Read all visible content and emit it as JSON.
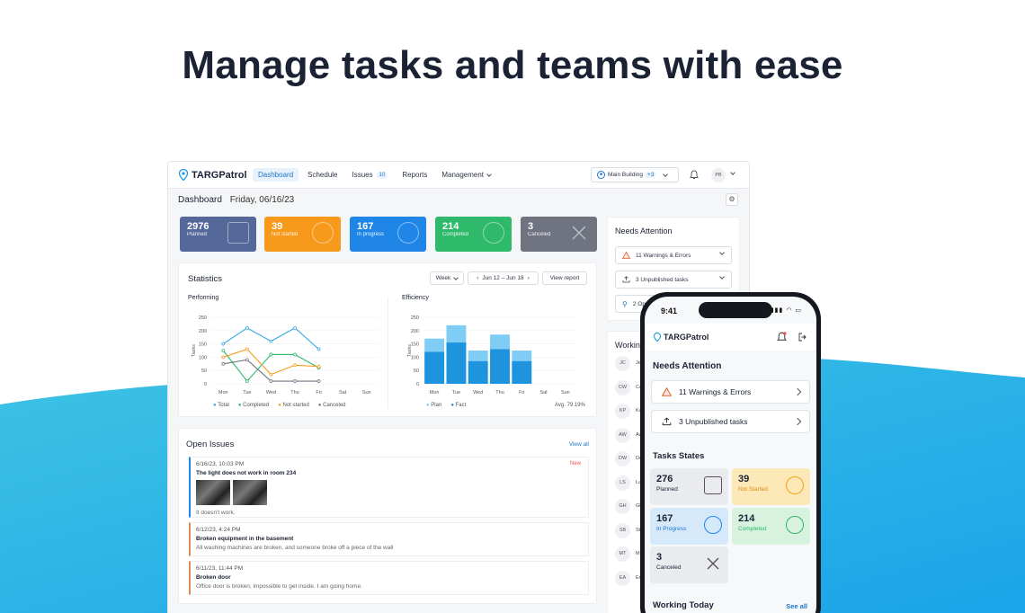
{
  "hero": {
    "title": "Manage tasks and teams with ease"
  },
  "app": {
    "brand": "TARGPatrol",
    "nav": [
      {
        "label": "Dashboard",
        "active": true
      },
      {
        "label": "Schedule"
      },
      {
        "label": "Issues",
        "badge": "10"
      },
      {
        "label": "Reports"
      },
      {
        "label": "Management"
      }
    ],
    "building": {
      "label": "Main Building",
      "extra": "+3"
    },
    "user_initials": "PB",
    "dashboard_title": "Dashboard",
    "dashboard_date": "Friday, 06/16/23"
  },
  "stats": [
    {
      "value": "2976",
      "label": "Planned",
      "color": "#4e5f8c"
    },
    {
      "value": "39",
      "label": "Not started",
      "color": "#f79a1c"
    },
    {
      "value": "167",
      "label": "In progress",
      "color": "#1f86e8"
    },
    {
      "value": "214",
      "label": "Completed",
      "color": "#2fb96a"
    },
    {
      "value": "3",
      "label": "Canceled",
      "color": "#6f7480"
    }
  ],
  "statistics": {
    "title": "Statistics",
    "period": "Week",
    "range": "Jun 12 – Jun 18",
    "view_report": "View report",
    "avg": "Avg. 79.19%"
  },
  "chart_data": [
    {
      "type": "line",
      "title": "Performing",
      "ylabel": "Tasks",
      "categories": [
        "Mon",
        "Tue",
        "Wed",
        "Thu",
        "Fri",
        "Sat",
        "Sun"
      ],
      "yticks": [
        0,
        50,
        100,
        150,
        200,
        250
      ],
      "ylim": [
        0,
        250
      ],
      "series": [
        {
          "name": "Total",
          "color": "#35a9e0",
          "values": [
            150,
            210,
            160,
            210,
            130
          ]
        },
        {
          "name": "Completed",
          "color": "#2fb96a",
          "values": [
            125,
            10,
            110,
            110,
            60
          ]
        },
        {
          "name": "Not started",
          "color": "#f79a1c",
          "values": [
            100,
            130,
            35,
            70,
            65
          ]
        },
        {
          "name": "Canceled",
          "color": "#6f7480",
          "values": [
            75,
            90,
            10,
            10,
            10
          ]
        }
      ]
    },
    {
      "type": "bar",
      "title": "Efficiency",
      "ylabel": "Tasks",
      "categories": [
        "Mon",
        "Tue",
        "Wed",
        "Thu",
        "Fri",
        "Sat",
        "Sun"
      ],
      "yticks": [
        0,
        50,
        100,
        150,
        200,
        250
      ],
      "ylim": [
        0,
        250
      ],
      "series": [
        {
          "name": "Plan",
          "color": "#7fcdf5",
          "values": [
            170,
            220,
            125,
            185,
            125
          ]
        },
        {
          "name": "Fact",
          "color": "#1f94de",
          "values": [
            120,
            155,
            85,
            130,
            85
          ]
        }
      ]
    }
  ],
  "needs_attention": {
    "title": "Needs Attention",
    "rows": [
      "11 Warnings & Errors",
      "3 Unpublished tasks",
      "2 Open"
    ]
  },
  "working": {
    "title": "Working",
    "people": [
      {
        "initials": "JC",
        "text": "Je"
      },
      {
        "initials": "CW",
        "text": "Ca"
      },
      {
        "initials": "KP",
        "text": "Ka"
      },
      {
        "initials": "AW",
        "text": "Aw"
      },
      {
        "initials": "DW",
        "text": "De"
      },
      {
        "initials": "LS",
        "text": "La"
      },
      {
        "initials": "GH",
        "text": "Gl"
      },
      {
        "initials": "SB",
        "text": "St"
      },
      {
        "initials": "MT",
        "text": "Mi"
      },
      {
        "initials": "EA",
        "text": "Er"
      }
    ]
  },
  "issues": {
    "title": "Open Issues",
    "view_all": "View all",
    "items": [
      {
        "time": "6/16/23, 10:03 PM",
        "title": "The light does not work in room 234",
        "desc": "It doesn't work.",
        "tag": "New",
        "color": "#1f86e8"
      },
      {
        "time": "6/12/23, 4:24 PM",
        "title": "Broken equipment in the basement",
        "desc": "All washing machines are broken, and someone broke off a piece of the wall",
        "color": "#e07a4a"
      },
      {
        "time": "6/11/23, 11:44 PM",
        "title": "Broken door",
        "desc": "Office door is broken, impossible to get inside. I am going home.",
        "color": "#e07a4a"
      }
    ]
  },
  "phone": {
    "time": "9:41",
    "brand": "TARGPatrol",
    "attention_title": "Needs Attention",
    "attention": [
      "11 Warnings & Errors",
      "3 Unpublished tasks"
    ],
    "states_title": "Tasks States",
    "states": [
      {
        "value": "276",
        "label": "Planned"
      },
      {
        "value": "39",
        "label": "Not Started"
      },
      {
        "value": "167",
        "label": "In Progress"
      },
      {
        "value": "214",
        "label": "Completed"
      },
      {
        "value": "3",
        "label": "Canceled"
      }
    ],
    "working_title": "Working Today",
    "see_all": "See all"
  }
}
